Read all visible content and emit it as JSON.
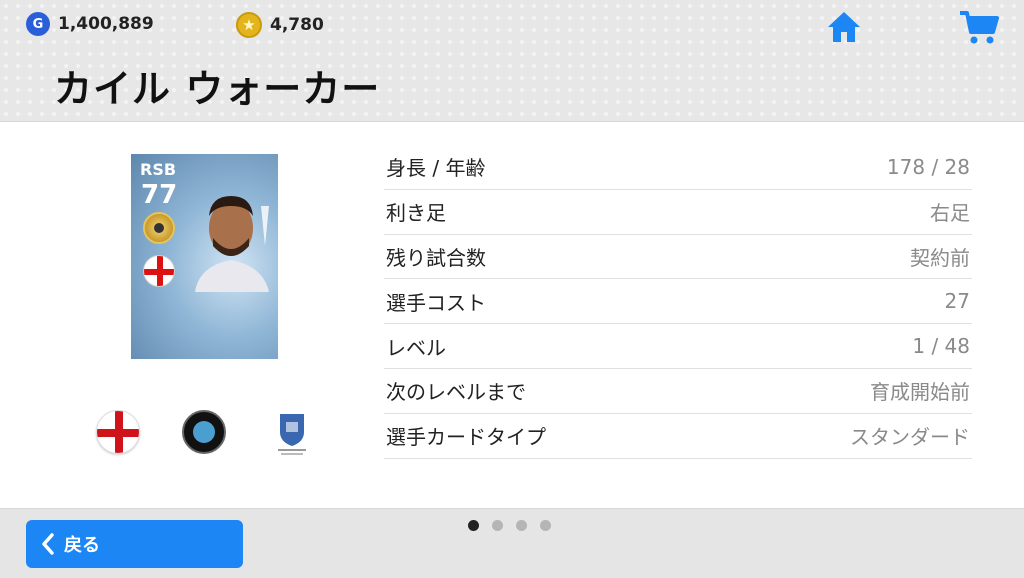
{
  "header": {
    "gp_icon_letter": "G",
    "gp_amount": "1,400,889",
    "coin_icon_glyph": "★",
    "coin_amount": "4,780",
    "title": "カイル ウォーカー",
    "icons": [
      "home-icon",
      "cart-icon",
      "gp-icon",
      "coin-icon"
    ],
    "accent_color": "#1b86f4"
  },
  "player_card": {
    "position": "RSB",
    "rating": "77"
  },
  "player_icons": [
    "england-flag-icon",
    "club-crest-icon",
    "league-logo-icon"
  ],
  "info": [
    {
      "label": "身長 / 年齢",
      "value": "178 / 28"
    },
    {
      "label": "利き足",
      "value": "右足"
    },
    {
      "label": "残り試合数",
      "value": "契約前"
    },
    {
      "label": "選手コスト",
      "value": "27"
    },
    {
      "label": "レベル",
      "value": "1 / 48"
    },
    {
      "label": "次のレベルまで",
      "value": "育成開始前"
    },
    {
      "label": "選手カードタイプ",
      "value": "スタンダード"
    }
  ],
  "pager": {
    "pages": 4,
    "active": 1
  },
  "footer": {
    "back_label": "戻る",
    "back_icon": "chevron-left-icon"
  }
}
